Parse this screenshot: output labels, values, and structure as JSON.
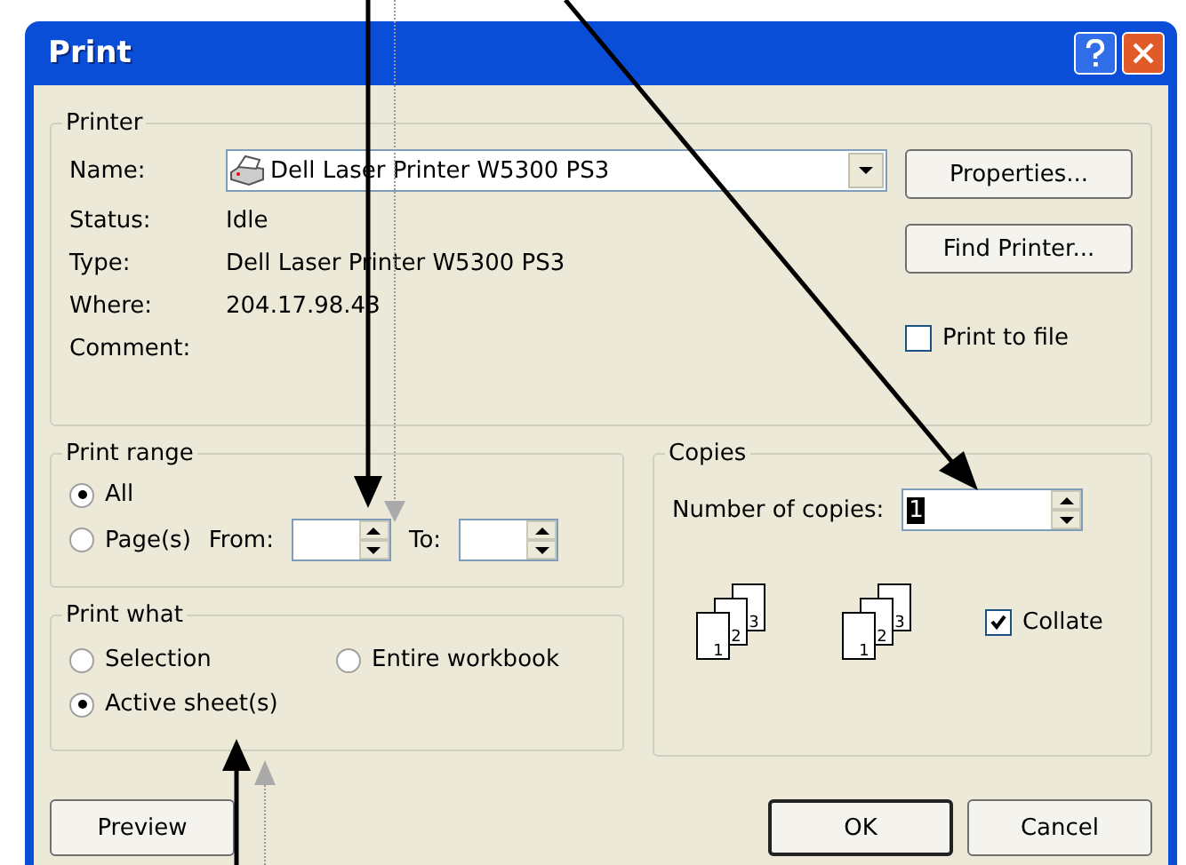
{
  "window": {
    "title": "Print"
  },
  "printer": {
    "legend": "Printer",
    "name_label": "Name:",
    "name_value": "Dell Laser Printer W5300 PS3",
    "properties_button": "Properties...",
    "find_button": "Find Printer...",
    "info": [
      {
        "label": "Status:",
        "value": "Idle"
      },
      {
        "label": "Type:",
        "value": "Dell Laser Printer W5300 PS3"
      },
      {
        "label": "Where:",
        "value": "204.17.98.43"
      },
      {
        "label": "Comment:"
      }
    ],
    "print_to_file": {
      "label": "Print to file",
      "checked": false
    }
  },
  "print_range": {
    "legend": "Print range",
    "options": [
      {
        "label": "All",
        "selected": true
      },
      {
        "label": "Page(s)",
        "selected": false
      }
    ],
    "from_label": "From:",
    "to_label": "To:"
  },
  "print_what": {
    "legend": "Print what",
    "options": [
      {
        "label": "Selection",
        "selected": false
      },
      {
        "label": "Entire workbook",
        "selected": false
      },
      {
        "label": "Active sheet(s)",
        "selected": true
      }
    ]
  },
  "copies": {
    "legend": "Copies",
    "number_label": "Number of copies:",
    "number_value": "1",
    "stacks": [
      {
        "pages": [
          "1",
          "2",
          "3"
        ]
      },
      {
        "pages": [
          "1",
          "2",
          "3"
        ]
      }
    ],
    "collate": {
      "label": "Collate",
      "checked": true
    }
  },
  "buttons": [
    {
      "label": "Preview",
      "default": false
    },
    {
      "label": "OK",
      "default": true
    },
    {
      "label": "Cancel",
      "default": false
    }
  ]
}
